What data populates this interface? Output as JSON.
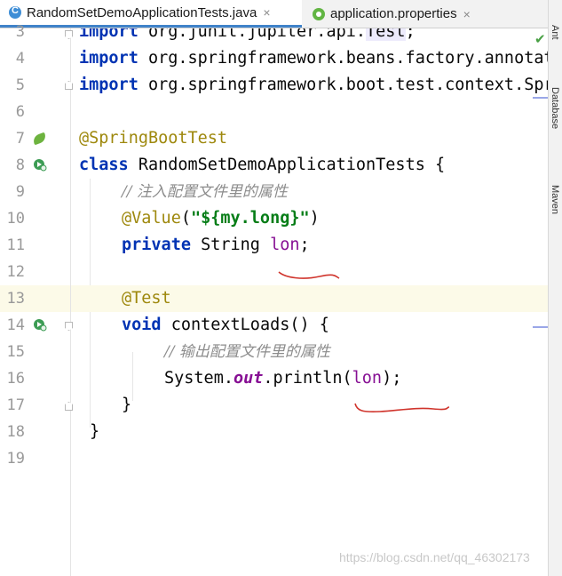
{
  "tabs": [
    {
      "label": "RandomSetDemoApplicationTests.java",
      "close": "×",
      "icon": "java-class-icon",
      "active": true
    },
    {
      "label": "application.properties",
      "close": "×",
      "icon": "properties-file-icon",
      "active": false
    }
  ],
  "right_sidebar": [
    "Ant",
    "Database",
    "Maven"
  ],
  "line_numbers": [
    "3",
    "4",
    "5",
    "6",
    "7",
    "8",
    "9",
    "10",
    "11",
    "12",
    "13",
    "14",
    "15",
    "16",
    "17",
    "18",
    "19"
  ],
  "code": {
    "l3": {
      "kw": "import",
      "text": " org.junit.jupiter.api.",
      "hl": "Test",
      "end": ";"
    },
    "l4": {
      "kw": "import",
      "text": " org.springframework.beans.factory.annotation.Value;"
    },
    "l5": {
      "kw": "import",
      "text": " org.springframework.boot.test.context.SpringBootTest;"
    },
    "l7": {
      "ann": "@SpringBootTest"
    },
    "l8": {
      "kw": "class",
      "text": " RandomSetDemoApplicationTests {"
    },
    "l9": {
      "comment": "// 注入配置文件里的属性"
    },
    "l10": {
      "ann": "@Value",
      "open": "(",
      "str": "\"${my.long}\"",
      "close": ")"
    },
    "l11": {
      "kw": "private",
      "text": " String ",
      "var": "lon",
      "end": ";"
    },
    "l13": {
      "ann": "@Test"
    },
    "l14": {
      "kw": "void",
      "text": " contextLoads() {"
    },
    "l15": {
      "comment": "// 输出配置文件里的属性"
    },
    "l16": {
      "pre": "System.",
      "field": "out",
      "mid": ".println(",
      "var": "lon",
      "end": ");"
    },
    "l17": {
      "text": "}"
    },
    "l18": {
      "text": "}"
    }
  },
  "watermark": "https://blog.csdn.net/qq_46302173",
  "colors": {
    "keyword": "#0033b3",
    "annotation": "#9e880d",
    "string": "#067d17",
    "comment": "#8c8c8c",
    "field": "#871094",
    "annotation_pen": "#d0342c"
  }
}
